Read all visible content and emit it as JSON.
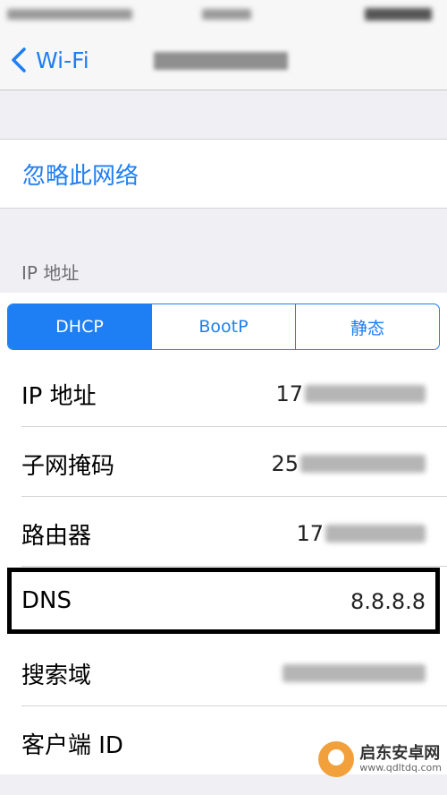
{
  "nav": {
    "back_label": "Wi-Fi"
  },
  "forget_network": "忽略此网络",
  "ip_section": {
    "header": "IP 地址",
    "segments": [
      {
        "label": "DHCP",
        "selected": true
      },
      {
        "label": "BootP",
        "selected": false
      },
      {
        "label": "静态",
        "selected": false
      }
    ]
  },
  "fields": {
    "ip": {
      "label": "IP 地址",
      "value_visible": "17"
    },
    "subnet": {
      "label": "子网掩码",
      "value_visible": "25"
    },
    "router": {
      "label": "路由器",
      "value_visible": "17"
    },
    "dns": {
      "label": "DNS",
      "value": "8.8.8.8"
    },
    "search_domain": {
      "label": "搜索域"
    },
    "client_id": {
      "label": "客户端 ID"
    }
  },
  "watermark": {
    "title": "启东安卓网",
    "url": "www.qdltdq.com"
  },
  "colors": {
    "accent": "#1e7ef3",
    "background": "#efeff4",
    "highlight_border": "#000000"
  }
}
